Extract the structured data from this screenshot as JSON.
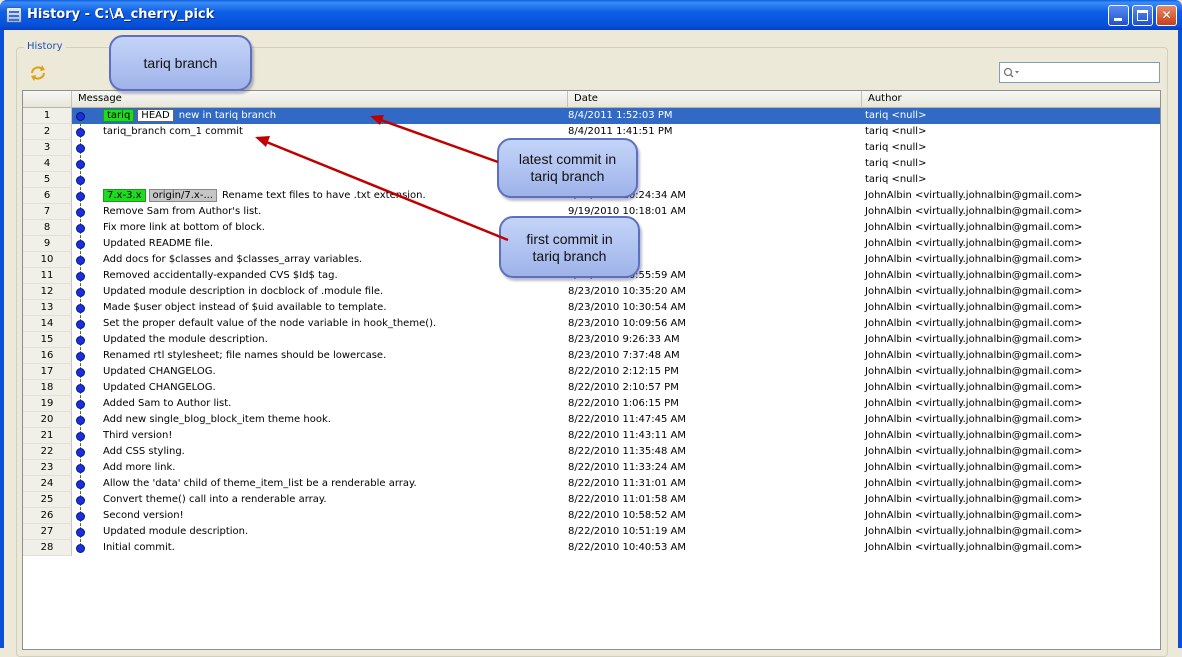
{
  "window": {
    "title": "History - C:\\A_cherry_pick",
    "minimize_label": "",
    "maximize_label": "",
    "close_label": "✕"
  },
  "panel": {
    "label": "History",
    "refresh_icon": "refresh-icon"
  },
  "search": {
    "placeholder": "",
    "value": "",
    "icon": "search-icon"
  },
  "table": {
    "columns": [
      "",
      "Message",
      "Date",
      "Author"
    ],
    "rows": [
      {
        "num": "1",
        "tags": [
          {
            "text": "tariq",
            "style": "green"
          },
          {
            "text": "HEAD",
            "style": "white"
          }
        ],
        "message": "new in tariq branch",
        "date": "8/4/2011 1:52:03 PM",
        "author": "tariq <null>",
        "selected": true
      },
      {
        "num": "2",
        "tags": [],
        "message": "tariq_branch com_1 commit",
        "date": "8/4/2011 1:41:51 PM",
        "author": "tariq <null>"
      },
      {
        "num": "3",
        "tags": [],
        "message": "",
        "date": "46 PM",
        "author": "tariq <null>"
      },
      {
        "num": "4",
        "tags": [],
        "message": "",
        "date": "09 PM",
        "author": "tariq <null>"
      },
      {
        "num": "5",
        "tags": [],
        "message": "",
        "date": "45 PM",
        "author": "tariq <null>"
      },
      {
        "num": "6",
        "tags": [
          {
            "text": "7.x-3.x",
            "style": "green"
          },
          {
            "text": "origin/7.x-...",
            "style": "gray"
          }
        ],
        "message": "Rename text files to have .txt extension.",
        "date": "9/19/2010 10:24:34 AM",
        "author": "JohnAlbin <virtually.johnalbin@gmail.com>"
      },
      {
        "num": "7",
        "tags": [],
        "message": "Remove Sam from Author's list.",
        "date": "9/19/2010 10:18:01 AM",
        "author": "JohnAlbin <virtually.johnalbin@gmail.com>"
      },
      {
        "num": "8",
        "tags": [],
        "message": "Fix more link at bottom of block.",
        "date": "16 AM",
        "author": "JohnAlbin <virtually.johnalbin@gmail.com>"
      },
      {
        "num": "9",
        "tags": [],
        "message": "Updated README file.",
        "date": "17 AM",
        "author": "JohnAlbin <virtually.johnalbin@gmail.com>"
      },
      {
        "num": "10",
        "tags": [],
        "message": "Add docs for $classes and $classes_array variables.",
        "date": "3:20 AM",
        "author": "JohnAlbin <virtually.johnalbin@gmail.com>"
      },
      {
        "num": "11",
        "tags": [],
        "message": "Removed accidentally-expanded CVS $Id$ tag.",
        "date": "8/23/2010 10:55:59 AM",
        "author": "JohnAlbin <virtually.johnalbin@gmail.com>"
      },
      {
        "num": "12",
        "tags": [],
        "message": "Updated module description in docblock of .module file.",
        "date": "8/23/2010 10:35:20 AM",
        "author": "JohnAlbin <virtually.johnalbin@gmail.com>"
      },
      {
        "num": "13",
        "tags": [],
        "message": "Made $user object instead of $uid available to template.",
        "date": "8/23/2010 10:30:54 AM",
        "author": "JohnAlbin <virtually.johnalbin@gmail.com>"
      },
      {
        "num": "14",
        "tags": [],
        "message": "Set the proper default value of the node variable in hook_theme().",
        "date": "8/23/2010 10:09:56 AM",
        "author": "JohnAlbin <virtually.johnalbin@gmail.com>"
      },
      {
        "num": "15",
        "tags": [],
        "message": "Updated the module description.",
        "date": "8/23/2010 9:26:33 AM",
        "author": "JohnAlbin <virtually.johnalbin@gmail.com>"
      },
      {
        "num": "16",
        "tags": [],
        "message": "Renamed rtl stylesheet; file names should be lowercase.",
        "date": "8/23/2010 7:37:48 AM",
        "author": "JohnAlbin <virtually.johnalbin@gmail.com>"
      },
      {
        "num": "17",
        "tags": [],
        "message": "Updated CHANGELOG.",
        "date": "8/22/2010 2:12:15 PM",
        "author": "JohnAlbin <virtually.johnalbin@gmail.com>"
      },
      {
        "num": "18",
        "tags": [],
        "message": "Updated CHANGELOG.",
        "date": "8/22/2010 2:10:57 PM",
        "author": "JohnAlbin <virtually.johnalbin@gmail.com>"
      },
      {
        "num": "19",
        "tags": [],
        "message": "Added Sam to Author list.",
        "date": "8/22/2010 1:06:15 PM",
        "author": "JohnAlbin <virtually.johnalbin@gmail.com>"
      },
      {
        "num": "20",
        "tags": [],
        "message": "Add new single_blog_block_item theme hook.",
        "date": "8/22/2010 11:47:45 AM",
        "author": "JohnAlbin <virtually.johnalbin@gmail.com>"
      },
      {
        "num": "21",
        "tags": [],
        "message": "Third version!",
        "date": "8/22/2010 11:43:11 AM",
        "author": "JohnAlbin <virtually.johnalbin@gmail.com>"
      },
      {
        "num": "22",
        "tags": [],
        "message": "Add CSS styling.",
        "date": "8/22/2010 11:35:48 AM",
        "author": "JohnAlbin <virtually.johnalbin@gmail.com>"
      },
      {
        "num": "23",
        "tags": [],
        "message": "Add more link.",
        "date": "8/22/2010 11:33:24 AM",
        "author": "JohnAlbin <virtually.johnalbin@gmail.com>"
      },
      {
        "num": "24",
        "tags": [],
        "message": "Allow the 'data' child of theme_item_list be a renderable array.",
        "date": "8/22/2010 11:31:01 AM",
        "author": "JohnAlbin <virtually.johnalbin@gmail.com>"
      },
      {
        "num": "25",
        "tags": [],
        "message": "Convert theme() call into a renderable array.",
        "date": "8/22/2010 11:01:58 AM",
        "author": "JohnAlbin <virtually.johnalbin@gmail.com>"
      },
      {
        "num": "26",
        "tags": [],
        "message": "Second version!",
        "date": "8/22/2010 10:58:52 AM",
        "author": "JohnAlbin <virtually.johnalbin@gmail.com>"
      },
      {
        "num": "27",
        "tags": [],
        "message": "Updated module description.",
        "date": "8/22/2010 10:51:19 AM",
        "author": "JohnAlbin <virtually.johnalbin@gmail.com>"
      },
      {
        "num": "28",
        "tags": [],
        "message": "Initial commit.",
        "date": "8/22/2010 10:40:53 AM",
        "author": "JohnAlbin <virtually.johnalbin@gmail.com>"
      }
    ]
  },
  "annotations": {
    "branch_label": "tariq branch",
    "latest_commit_line1": "latest commit in",
    "latest_commit_line2": "tariq branch",
    "first_commit_line1": "first commit in",
    "first_commit_line2": "tariq branch"
  },
  "colors": {
    "selection": "#316ac5",
    "tag_green": "#1fdb1f",
    "graph_dot": "#1a2fe0",
    "arrow": "#c00000",
    "callout": "#b3c5f2"
  }
}
